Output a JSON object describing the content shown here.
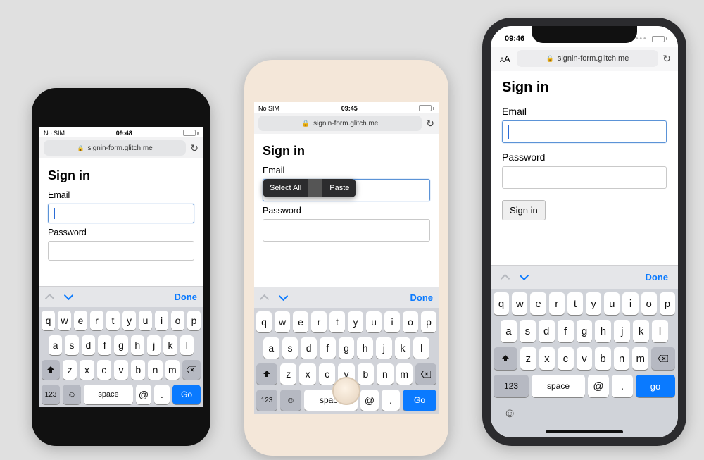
{
  "phones": [
    {
      "status": {
        "carrier": "No SIM",
        "time": "09:48"
      },
      "addressbar": {
        "url": "signin-form.glitch.me",
        "aA": ""
      },
      "page": {
        "heading": "Sign in",
        "email_label": "Email",
        "password_label": "Password"
      },
      "accessory": {
        "done": "Done"
      },
      "keyboard": {
        "row1": [
          "q",
          "w",
          "e",
          "r",
          "t",
          "y",
          "u",
          "i",
          "o",
          "p"
        ],
        "row2": [
          "a",
          "s",
          "d",
          "f",
          "g",
          "h",
          "j",
          "k",
          "l"
        ],
        "row3": [
          "z",
          "x",
          "c",
          "v",
          "b",
          "n",
          "m"
        ],
        "numkey": "123",
        "space": "space",
        "at": "@",
        "dot": ".",
        "go": "Go"
      }
    },
    {
      "status": {
        "carrier": "No SIM",
        "time": "09:45"
      },
      "addressbar": {
        "url": "signin-form.glitch.me"
      },
      "page": {
        "heading": "Sign in",
        "email_label": "Email",
        "password_label": "Password"
      },
      "tooltip": {
        "selectall": "Select All",
        "paste": "Paste"
      },
      "accessory": {
        "done": "Done"
      },
      "keyboard": {
        "row1": [
          "q",
          "w",
          "e",
          "r",
          "t",
          "y",
          "u",
          "i",
          "o",
          "p"
        ],
        "row2": [
          "a",
          "s",
          "d",
          "f",
          "g",
          "h",
          "j",
          "k",
          "l"
        ],
        "row3": [
          "z",
          "x",
          "c",
          "v",
          "b",
          "n",
          "m"
        ],
        "numkey": "123",
        "space": "space",
        "at": "@",
        "dot": ".",
        "go": "Go"
      }
    },
    {
      "status": {
        "time": "09:46"
      },
      "addressbar": {
        "aA": "AA",
        "url": "signin-form.glitch.me"
      },
      "page": {
        "heading": "Sign in",
        "email_label": "Email",
        "password_label": "Password",
        "submit": "Sign in"
      },
      "accessory": {
        "done": "Done"
      },
      "keyboard": {
        "row1": [
          "q",
          "w",
          "e",
          "r",
          "t",
          "y",
          "u",
          "i",
          "o",
          "p"
        ],
        "row2": [
          "a",
          "s",
          "d",
          "f",
          "g",
          "h",
          "j",
          "k",
          "l"
        ],
        "row3": [
          "z",
          "x",
          "c",
          "v",
          "b",
          "n",
          "m"
        ],
        "numkey": "123",
        "space": "space",
        "at": "@",
        "dot": ".",
        "go": "go"
      }
    }
  ]
}
